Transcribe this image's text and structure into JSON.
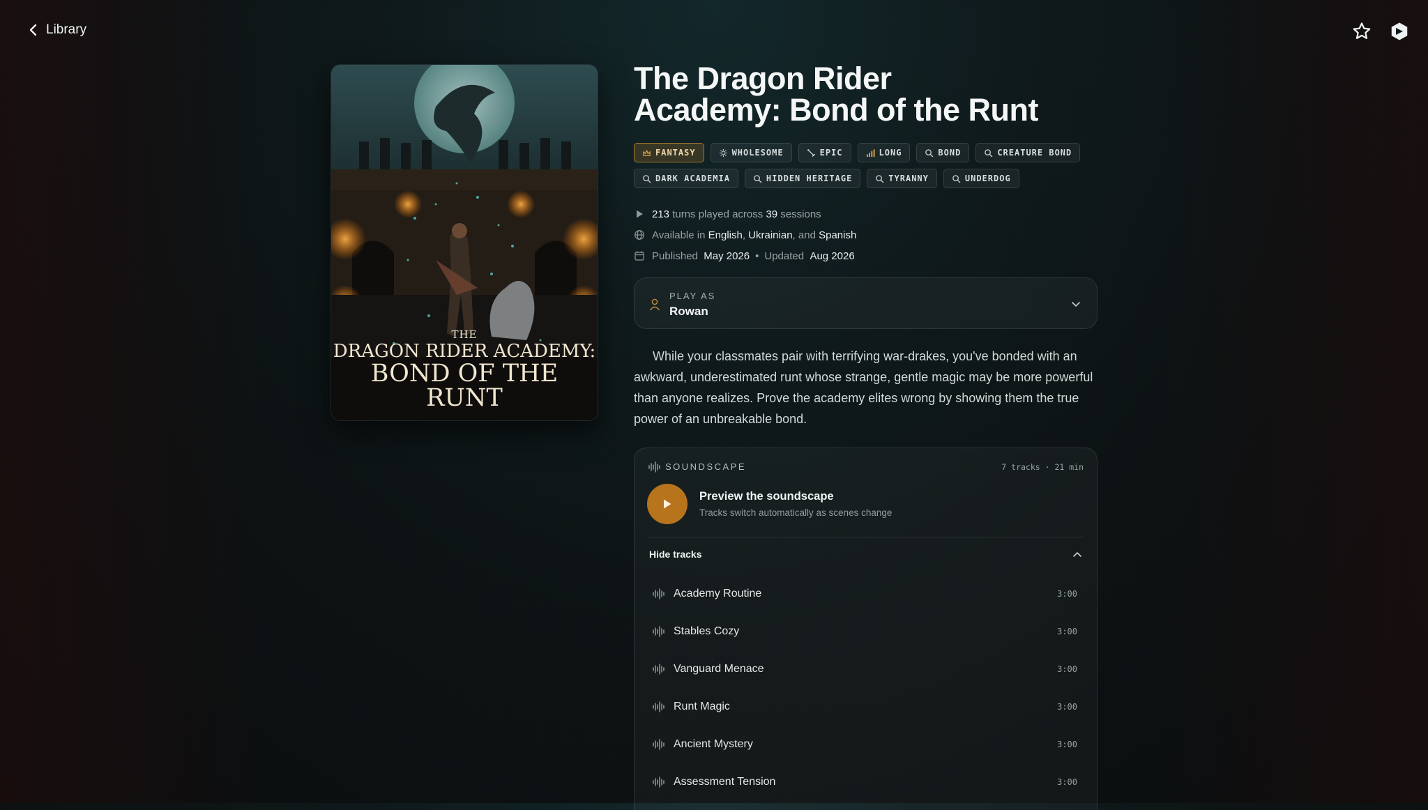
{
  "nav": {
    "back_label": "Library"
  },
  "story": {
    "title_line1": "The Dragon Rider",
    "title_line2": "Academy: Bond of the Runt",
    "cover": {
      "line_the": "THE",
      "line1": "DRAGON RIDER ACADEMY:",
      "line2": "BOND OF THE RUNT"
    },
    "tags": [
      {
        "label": "FANTASY",
        "icon": "crown-icon",
        "accent": true
      },
      {
        "label": "WHOLESOME",
        "icon": "sun-icon"
      },
      {
        "label": "EPIC",
        "icon": "sword-icon"
      },
      {
        "label": "LONG",
        "icon": "signal-bars-icon"
      },
      {
        "label": "BOND",
        "icon": "search-icon"
      },
      {
        "label": "CREATURE BOND",
        "icon": "search-icon"
      },
      {
        "label": "DARK ACADEMIA",
        "icon": "search-icon"
      },
      {
        "label": "HIDDEN HERITAGE",
        "icon": "search-icon"
      },
      {
        "label": "TYRANNY",
        "icon": "search-icon"
      },
      {
        "label": "UNDERDOG",
        "icon": "search-icon"
      }
    ],
    "stats": {
      "turns": "213",
      "turns_text": "turns played across",
      "sessions": "39",
      "sessions_text": "sessions"
    },
    "languages": {
      "prefix": "Available in",
      "lang1": "English",
      "sep1": ",",
      "lang2": "Ukrainian",
      "sep2": ", and",
      "lang3": "Spanish"
    },
    "dates": {
      "published_label": "Published",
      "published": "May 2026",
      "dot": "•",
      "updated_label": "Updated",
      "updated": "Aug 2026"
    },
    "play_as": {
      "label": "PLAY AS",
      "value": "Rowan"
    },
    "description": "While your classmates pair with terrifying war-drakes, you've bonded with an awkward, underestimated runt whose strange, gentle magic may be more powerful than anyone realizes. Prove the academy elites wrong by showing them the true power of an unbreakable bond."
  },
  "soundscape": {
    "label": "SOUNDSCAPE",
    "meta": "7 tracks · 21 min",
    "preview_title": "Preview the soundscape",
    "preview_sub": "Tracks switch automatically as scenes change",
    "hide_label": "Hide tracks",
    "tracks": [
      {
        "name": "Academy Routine",
        "duration": "3:00"
      },
      {
        "name": "Stables Cozy",
        "duration": "3:00"
      },
      {
        "name": "Vanguard Menace",
        "duration": "3:00"
      },
      {
        "name": "Runt Magic",
        "duration": "3:00"
      },
      {
        "name": "Ancient Mystery",
        "duration": "3:00"
      },
      {
        "name": "Assessment Tension",
        "duration": "3:00"
      }
    ]
  },
  "colors": {
    "accent": "#b7741c",
    "background": "#0d1213",
    "tag_accent": "#f1d7a8"
  }
}
